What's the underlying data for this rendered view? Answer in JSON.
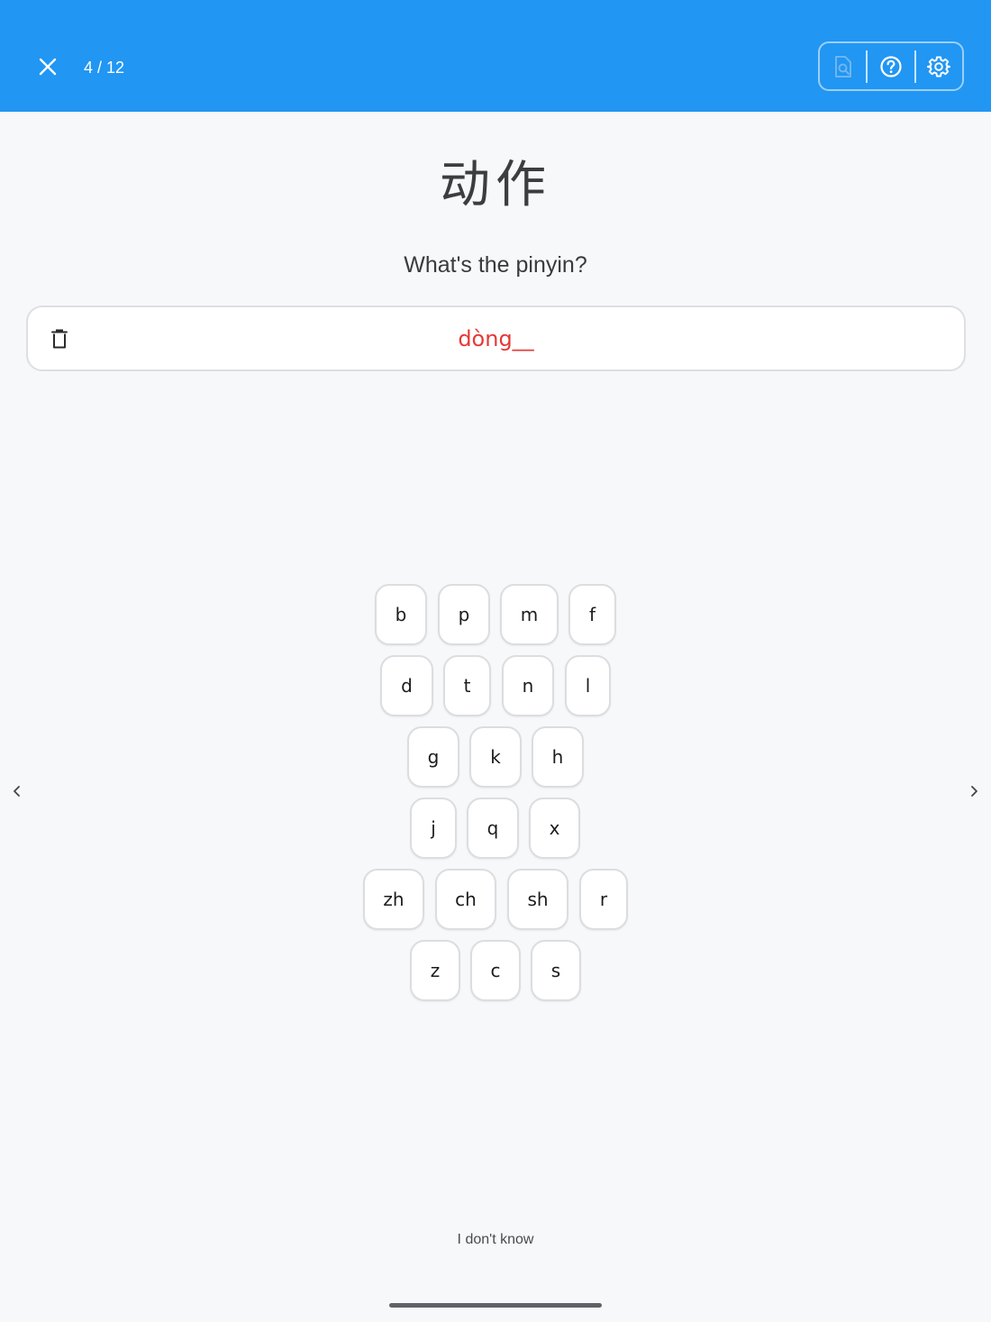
{
  "header": {
    "progress": "4 / 12",
    "close_icon": "close-icon",
    "tools": [
      {
        "icon": "document-search-icon",
        "enabled": false
      },
      {
        "icon": "help-icon",
        "enabled": true
      },
      {
        "icon": "gear-icon",
        "enabled": true
      }
    ]
  },
  "prompt": {
    "hanzi": "动作",
    "question": "What's the pinyin?"
  },
  "answer": {
    "value": "dòng__",
    "color": "#e53935",
    "clear_icon": "trash-icon"
  },
  "keyboard": {
    "rows": [
      [
        "b",
        "p",
        "m",
        "f"
      ],
      [
        "d",
        "t",
        "n",
        "l"
      ],
      [
        "g",
        "k",
        "h"
      ],
      [
        "j",
        "q",
        "x"
      ],
      [
        "zh",
        "ch",
        "sh",
        "r"
      ],
      [
        "z",
        "c",
        "s"
      ]
    ]
  },
  "nav": {
    "prev_icon": "chevron-left-icon",
    "next_icon": "chevron-right-icon"
  },
  "footer": {
    "dont_know_label": "I don't know"
  },
  "colors": {
    "header": "#2196f3",
    "background": "#f7f8fa",
    "answer_text": "#e53935"
  }
}
